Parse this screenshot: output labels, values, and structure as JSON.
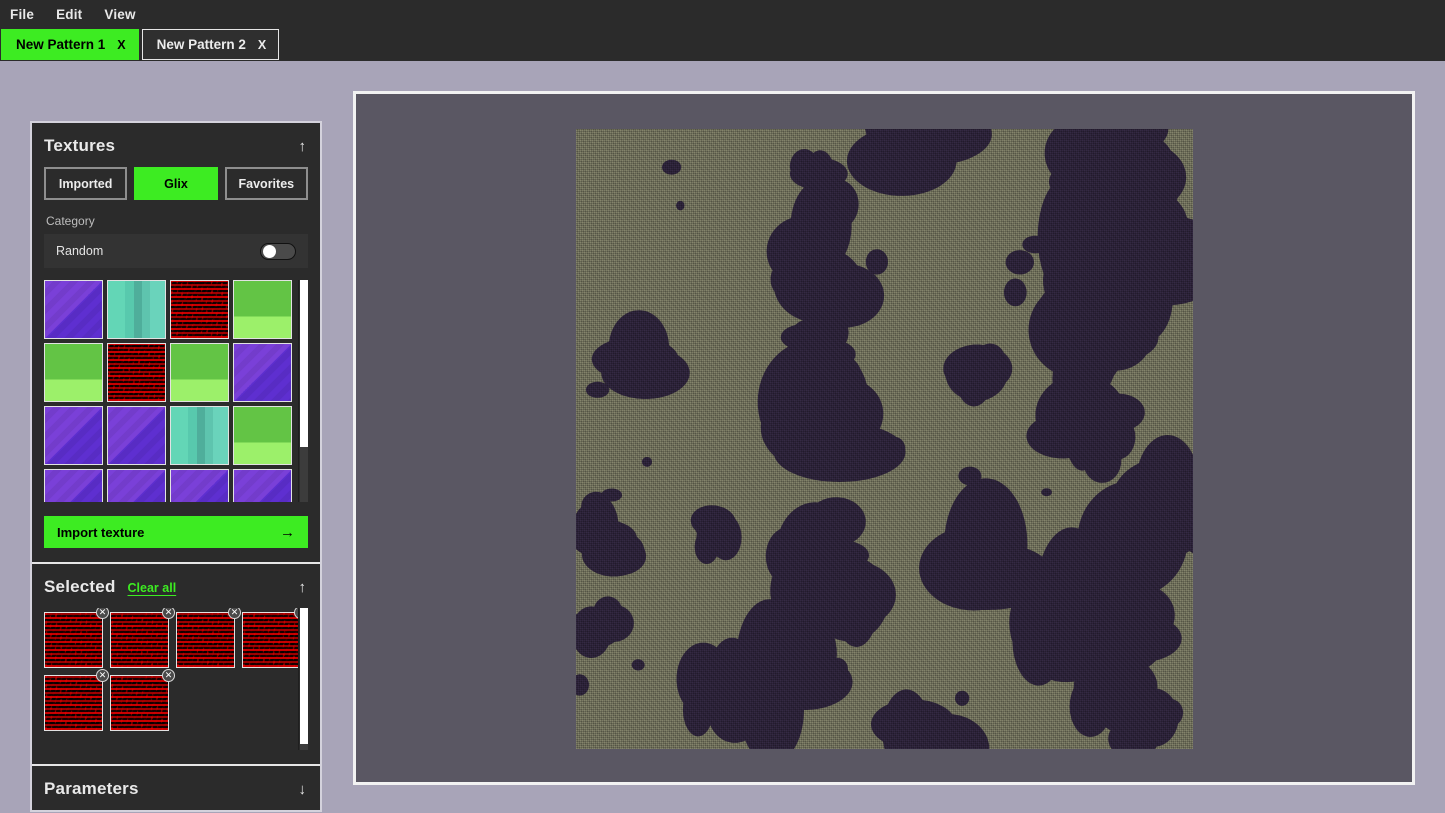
{
  "menubar": {
    "items": [
      {
        "label": "File"
      },
      {
        "label": "Edit"
      },
      {
        "label": "View"
      }
    ]
  },
  "tabs": [
    {
      "label": "New Pattern 1",
      "close": "X",
      "active": true
    },
    {
      "label": "New Pattern 2",
      "close": "X",
      "active": false
    }
  ],
  "sidebar": {
    "textures_panel": {
      "title": "Textures",
      "collapse_icon": "↑",
      "source_tabs": [
        {
          "label": "Imported",
          "active": false
        },
        {
          "label": "Glix",
          "active": true
        },
        {
          "label": "Favorites",
          "active": false
        }
      ],
      "category_label": "Category",
      "random_row": {
        "label": "Random",
        "toggle_state": "off"
      },
      "thumbnails": [
        "purple",
        "teal",
        "red",
        "green",
        "green",
        "red",
        "green",
        "purple",
        "purple",
        "purple",
        "teal",
        "green",
        "purple",
        "purple",
        "purple",
        "purple"
      ],
      "scroll_thumb_pct": 75,
      "import_button": {
        "label": "Import texture",
        "arrow_icon": "→"
      }
    },
    "selected_panel": {
      "title": "Selected",
      "clear_all_label": "Clear all",
      "collapse_icon": "↑",
      "remove_icon": "✕",
      "thumbnails": [
        "red",
        "red",
        "red",
        "red",
        "red",
        "red"
      ],
      "scroll_thumb_pct": 96
    },
    "parameters_panel": {
      "title": "Parameters",
      "expand_icon": "↓"
    }
  },
  "canvas": {
    "pattern_name": "New Pattern 1",
    "background_color": "#5a5763",
    "pattern_base_color": "#6d6d59",
    "pattern_blob_color": "#2b2238"
  },
  "colors": {
    "accent_green": "#3dec22",
    "app_background": "#a8a4b8",
    "panel_background": "#2b2b2b",
    "chrome_background": "#2b2b2b"
  }
}
